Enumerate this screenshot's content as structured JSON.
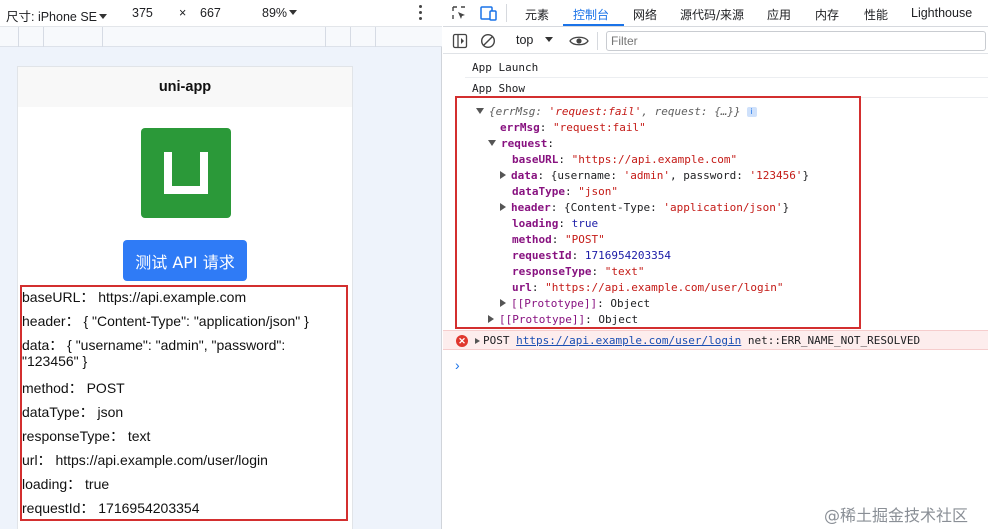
{
  "device_toolbar": {
    "device_label": "尺寸: iPhone SE",
    "width": "375",
    "times": "×",
    "height": "667",
    "zoom": "89%"
  },
  "phone": {
    "nav_title": "uni-app",
    "logo_icon": "uni-app-logo-icon",
    "api_button": "测试 API 请求",
    "info_lines": [
      "baseURL： https://api.example.com",
      "header： { \"Content-Type\": \"application/json\" }",
      "data： { \"username\": \"admin\", \"password\":",
      "\"123456\" }",
      "method： POST",
      "dataType： json",
      "responseType： text",
      "url： https://api.example.com/user/login",
      "loading： true",
      "requestId： 1716954203354"
    ]
  },
  "devtools": {
    "tabs": [
      "元素",
      "控制台",
      "网络",
      "源代码/来源",
      "应用",
      "内存",
      "性能",
      "Lighthouse"
    ],
    "active_tab": "控制台",
    "context": "top",
    "filter_placeholder": "Filter",
    "logs": [
      "App Launch",
      "App Show"
    ],
    "object": {
      "summary_prefix": "{errMsg: ",
      "summary_errmsg": "'request:fail'",
      "summary_mid": ", request: ",
      "summary_end": "{…}}",
      "info_badge": "i",
      "errMsg_key": "errMsg",
      "errMsg_val": "\"request:fail\"",
      "request_key": "request",
      "baseURL_key": "baseURL",
      "baseURL_val": "\"https://api.example.com\"",
      "data_key": "data",
      "data_open": "{username: ",
      "data_user": "'admin'",
      "data_mid": ", password: ",
      "data_pass": "'123456'",
      "data_close": "}",
      "dataType_key": "dataType",
      "dataType_val": "\"json\"",
      "header_key": "header",
      "header_open": "{Content-Type: ",
      "header_val": "'application/json'",
      "header_close": "}",
      "loading_key": "loading",
      "loading_val": "true",
      "method_key": "method",
      "method_val": "\"POST\"",
      "requestId_key": "requestId",
      "requestId_val": "1716954203354",
      "responseType_key": "responseType",
      "responseType_val": "\"text\"",
      "url_key": "url",
      "url_val": "\"https://api.example.com/user/login\"",
      "proto_key": "[[Prototype]]",
      "proto_val": "Object"
    },
    "error": {
      "method": "POST",
      "url": "https://api.example.com/user/login",
      "message": "net::ERR_NAME_NOT_RESOLVED"
    },
    "prompt": "›"
  },
  "watermark": "@稀土掘金技术社区",
  "colors": {
    "accent": "#1a73e8",
    "highlight_box": "#d32f2f",
    "uni_green": "#2b9939",
    "button_blue": "#2f7bf6",
    "error_bg": "#fdeded"
  }
}
